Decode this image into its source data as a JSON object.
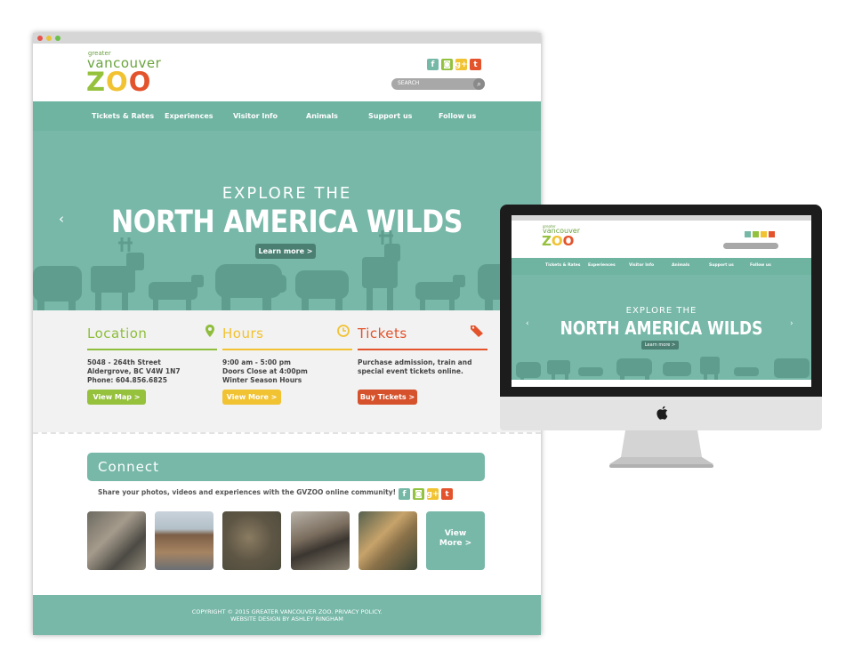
{
  "logo": {
    "small": "greater",
    "mid": "vancouver",
    "z": "Z",
    "o1": "O",
    "o2": "O"
  },
  "social": {
    "fb": "f",
    "ig": "◙",
    "gp": "g+",
    "tw": "t"
  },
  "search": {
    "placeholder": "SEARCH",
    "icon": "search-icon"
  },
  "nav": [
    "Tickets & Rates",
    "Experiences",
    "Visitor Info",
    "Animals",
    "Support us",
    "Follow us"
  ],
  "hero": {
    "subtitle": "EXPLORE THE",
    "title": "NORTH AMERICA WILDS",
    "button": "Learn more >",
    "prev": "‹",
    "next": "›"
  },
  "info": {
    "location": {
      "title": "Location",
      "lines": [
        "5048 - 264th Street",
        "Aldergrove, BC  V4W 1N7",
        "Phone: 604.856.6825"
      ],
      "button": "View Map >"
    },
    "hours": {
      "title": "Hours",
      "lines": [
        "9:00 am - 5:00 pm",
        "Doors Close at 4:00pm",
        "Winter Season Hours"
      ],
      "button": "View More >"
    },
    "tickets": {
      "title": "Tickets",
      "lines": [
        "Purchase admission, train and",
        "special event tickets online."
      ],
      "button": "Buy Tickets >"
    }
  },
  "connect": {
    "title": "Connect",
    "share": "Share your photos, videos and experiences with the GVZOO online community!",
    "view_more_1": "View",
    "view_more_2": "More >"
  },
  "footer": {
    "line1": "COPYRIGHT © 2015 GREATER VANCOUVER ZOO. PRIVACY POLICY.",
    "line2": "WEBSITE DESIGN BY ASHLEY RINGHAM"
  },
  "colors": {
    "teal": "#77b8a8",
    "green": "#95c13c",
    "yellow": "#f1c232",
    "orange": "#e3532c"
  }
}
